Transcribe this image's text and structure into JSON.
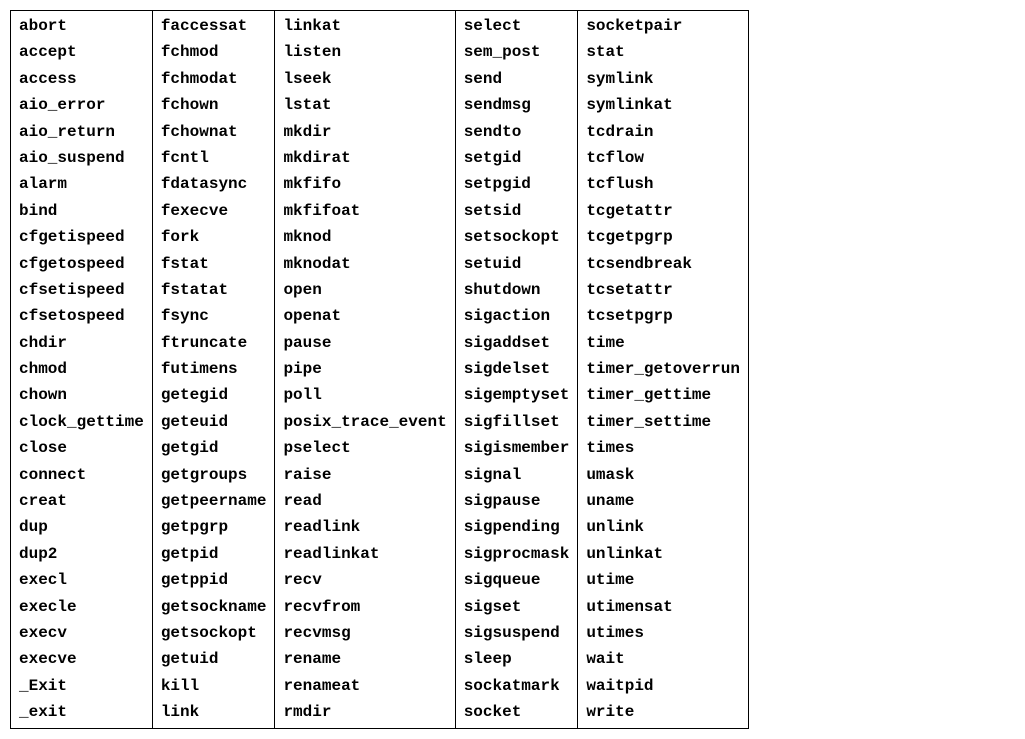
{
  "table": {
    "columns": [
      [
        "abort",
        "accept",
        "access",
        "aio_error",
        "aio_return",
        "aio_suspend",
        "alarm",
        "bind",
        "cfgetispeed",
        "cfgetospeed",
        "cfsetispeed",
        "cfsetospeed",
        "chdir",
        "chmod",
        "chown",
        "clock_gettime",
        "close",
        "connect",
        "creat",
        "dup",
        "dup2",
        "execl",
        "execle",
        "execv",
        "execve",
        "_Exit",
        "_exit"
      ],
      [
        "faccessat",
        "fchmod",
        "fchmodat",
        "fchown",
        "fchownat",
        "fcntl",
        "fdatasync",
        "fexecve",
        "fork",
        "fstat",
        "fstatat",
        "fsync",
        "ftruncate",
        "futimens",
        "getegid",
        "geteuid",
        "getgid",
        "getgroups",
        "getpeername",
        "getpgrp",
        "getpid",
        "getppid",
        "getsockname",
        "getsockopt",
        "getuid",
        "kill",
        "link"
      ],
      [
        "linkat",
        "listen",
        "lseek",
        "lstat",
        "mkdir",
        "mkdirat",
        "mkfifo",
        "mkfifoat",
        "mknod",
        "mknodat",
        "open",
        "openat",
        "pause",
        "pipe",
        "poll",
        "posix_trace_event",
        "pselect",
        "raise",
        "read",
        "readlink",
        "readlinkat",
        "recv",
        "recvfrom",
        "recvmsg",
        "rename",
        "renameat",
        "rmdir"
      ],
      [
        "select",
        "sem_post",
        "send",
        "sendmsg",
        "sendto",
        "setgid",
        "setpgid",
        "setsid",
        "setsockopt",
        "setuid",
        "shutdown",
        "sigaction",
        "sigaddset",
        "sigdelset",
        "sigemptyset",
        "sigfillset",
        "sigismember",
        "signal",
        "sigpause",
        "sigpending",
        "sigprocmask",
        "sigqueue",
        "sigset",
        "sigsuspend",
        "sleep",
        "sockatmark",
        "socket"
      ],
      [
        "socketpair",
        "stat",
        "symlink",
        "symlinkat",
        "tcdrain",
        "tcflow",
        "tcflush",
        "tcgetattr",
        "tcgetpgrp",
        "tcsendbreak",
        "tcsetattr",
        "tcsetpgrp",
        "time",
        "timer_getoverrun",
        "timer_gettime",
        "timer_settime",
        "times",
        "umask",
        "uname",
        "unlink",
        "unlinkat",
        "utime",
        "utimensat",
        "utimes",
        "wait",
        "waitpid",
        "write"
      ]
    ]
  }
}
